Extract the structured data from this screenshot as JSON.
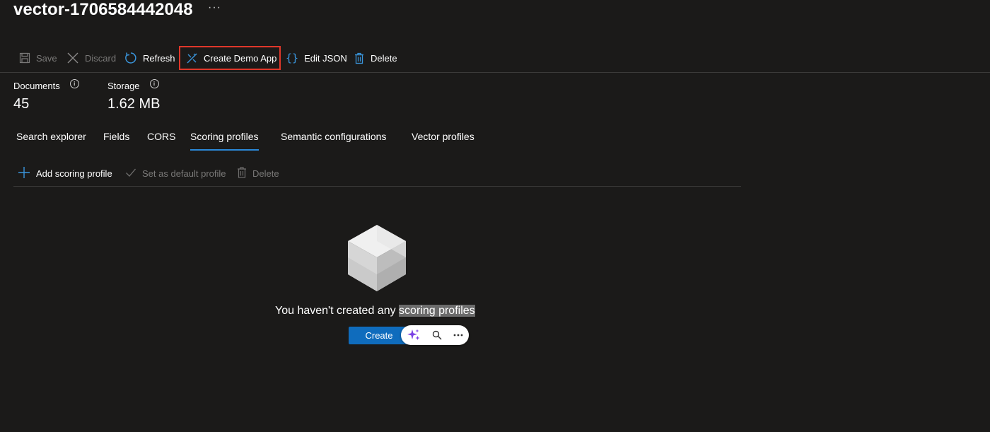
{
  "header": {
    "title": "vector-1706584442048",
    "more": "···"
  },
  "toolbar": {
    "save": "Save",
    "discard": "Discard",
    "refresh": "Refresh",
    "create_demo_app": "Create Demo App",
    "edit_json": "Edit JSON",
    "delete": "Delete"
  },
  "stats": {
    "documents_label": "Documents",
    "documents_value": "45",
    "storage_label": "Storage",
    "storage_value": "1.62 MB",
    "info_glyph": "i"
  },
  "tabs": [
    {
      "label": "Search explorer"
    },
    {
      "label": "Fields"
    },
    {
      "label": "CORS"
    },
    {
      "label": "Scoring profiles",
      "active": true
    },
    {
      "label": "Semantic configurations"
    },
    {
      "label": "Vector profiles"
    }
  ],
  "subtoolbar": {
    "add": "Add scoring profile",
    "set_default": "Set as default profile",
    "delete": "Delete"
  },
  "empty_state": {
    "message_prefix": "You haven't created any ",
    "message_highlight": "scoring profiles",
    "create_button": "Create"
  },
  "colors": {
    "background": "#1b1a19",
    "accent": "#0f6cbd",
    "highlight_border": "#e0372a",
    "copilot_purple": "#7b3fe4"
  }
}
